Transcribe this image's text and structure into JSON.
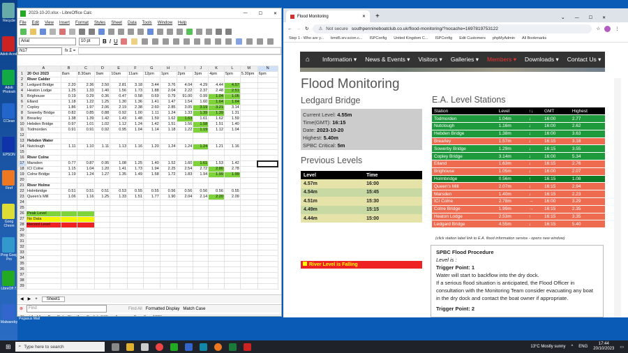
{
  "desktop": {
    "icons": [
      {
        "label": "Recycle",
        "color": "#6aa"
      },
      {
        "label": "Adob Acrob",
        "color": "#c22"
      },
      {
        "label": "Adob Photosh",
        "color": "#1a4"
      },
      {
        "label": "CClean",
        "color": "#26c"
      },
      {
        "label": "EPSON",
        "color": "#13a"
      },
      {
        "label": "Firef",
        "color": "#e72"
      },
      {
        "label": "Goog Chrom",
        "color": "#dd3"
      },
      {
        "label": "Prog Goog Pro",
        "color": "#39c"
      },
      {
        "label": "LibreOff 7.",
        "color": "#2a2"
      },
      {
        "label": "Malwareby",
        "color": "#36c"
      }
    ],
    "pegasus": "Pegasus Mail"
  },
  "calc": {
    "title": "2023-10-20.xlsx - LibreOffice Calc",
    "menu": [
      "File",
      "Edit",
      "View",
      "Insert",
      "Format",
      "Styles",
      "Sheet",
      "Data",
      "Tools",
      "Window",
      "Help"
    ],
    "font": "Arial",
    "size": "10 pt",
    "namebox": "N17",
    "formula_icons": "fx Σ =",
    "columns": [
      "",
      "A",
      "B",
      "C",
      "D",
      "E",
      "F",
      "G",
      "H",
      "I",
      "J",
      "K",
      "L",
      "M",
      "N"
    ],
    "rows": [
      [
        "1",
        "20 Oct 2023",
        "8am",
        "8.30am",
        "9am",
        "10am",
        "11am",
        "12pm",
        "1pm",
        "2pm",
        "3pm",
        "4pm",
        "5pm",
        "5.30pm",
        "6pm"
      ],
      [
        "2",
        "River Calder",
        "",
        "",
        "",
        "",
        "",
        "",
        "",
        "",
        "",
        "",
        "",
        "",
        ""
      ],
      [
        "3",
        "Ledgard Bridge",
        "2.20",
        "2.36",
        "2.50",
        "2.81",
        "3.18",
        "3.44",
        "3.76",
        "4.04",
        "4.29",
        "4.44",
        "4.57",
        "",
        ""
      ],
      [
        "4",
        "Heaton Lodge",
        "1.25",
        "1.33",
        "1.40",
        "1.56",
        "1.73",
        "1.88",
        "2.04",
        "2.22",
        "2.37",
        "2.48",
        "2.51",
        "",
        ""
      ],
      [
        "5",
        "Brighouse",
        "0.19",
        "0.29",
        "0.36",
        "0.47",
        "0.58",
        "0.69",
        "0.79",
        "91.00",
        "0.99",
        "1.04",
        "1.05",
        "",
        ""
      ],
      [
        "6",
        "Elland",
        "1.18",
        "1.22",
        "1.25",
        "1.30",
        "1.36",
        "1.41",
        "1.47",
        "1.54",
        "1.60",
        "1.64",
        "1.64",
        "",
        ""
      ],
      [
        "7",
        "Copley",
        "1.86",
        "1.97",
        "2.06",
        "2.19",
        "2.38",
        "2.60",
        "2.85",
        "3.05",
        "3.19",
        "3.21",
        "3.14",
        "",
        ""
      ],
      [
        "8",
        "Sowerby Bridge",
        "0.82",
        "0.85",
        "0.88",
        "0.92",
        "1.00",
        "1.11",
        "1.24",
        "1.33",
        "1.39",
        "1.39",
        "1.31",
        "",
        ""
      ],
      [
        "9",
        "Brearley",
        "1.38",
        "1.39",
        "1.42",
        "1.43",
        "1.48",
        "1.59",
        "1.62",
        "1.63",
        "1.61",
        "1.62",
        "1.59",
        "",
        ""
      ],
      [
        "10",
        "Hebden Bridge",
        "0.97",
        "1.01",
        "1.02",
        "1.12",
        "1.24",
        "1.42",
        "1.51",
        "1.56",
        "1.58",
        "1.51",
        "1.40",
        "",
        ""
      ],
      [
        "11",
        "Todmorden",
        "0.91",
        "0.91",
        "0.92",
        "0.95",
        "1.04",
        "1.14",
        "1.18",
        "1.22",
        "1.19",
        "1.12",
        "1.04",
        "",
        ""
      ],
      [
        "12",
        "",
        "",
        "",
        "",
        "",
        "",
        "",
        "",
        "",
        "",
        "",
        "",
        "",
        ""
      ],
      [
        "13",
        "Hebden Water",
        "",
        "",
        "",
        "",
        "",
        "",
        "",
        "",
        "",
        "",
        "",
        "",
        ""
      ],
      [
        "14",
        "Nutclough",
        "1.11",
        "1.10",
        "1.11",
        "1.13",
        "1.16",
        "1.20",
        "1.24",
        "1.24",
        "1.24",
        "1.21",
        "1.16",
        "",
        ""
      ],
      [
        "15",
        "",
        "",
        "",
        "",
        "",
        "",
        "",
        "",
        "",
        "",
        "",
        "",
        "",
        ""
      ],
      [
        "16",
        "River Colne",
        "",
        "",
        "",
        "",
        "",
        "",
        "",
        "",
        "",
        "",
        "",
        "",
        ""
      ],
      [
        "17",
        "Marsden",
        "0.77",
        "0.87",
        "0.95",
        "1.08",
        "1.25",
        "1.40",
        "1.52",
        "1.60",
        "1.61",
        "1.53",
        "1.42",
        "",
        ""
      ],
      [
        "18",
        "ICI Colne",
        "1.15",
        "1.04",
        "1.20",
        "1.41",
        "1.73",
        "1.94",
        "2.25",
        "2.54",
        "2.72",
        "2.80",
        "2.78",
        "",
        ""
      ],
      [
        "19",
        "Colne Bridge",
        "1.19",
        "1.24",
        "1.27",
        "1.35",
        "1.49",
        "1.58",
        "1.72",
        "1.83",
        "1.94",
        "1.99",
        "1.99",
        "",
        ""
      ],
      [
        "20",
        "",
        "",
        "",
        "",
        "",
        "",
        "",
        "",
        "",
        "",
        "",
        "",
        "",
        ""
      ],
      [
        "21",
        "River Holme",
        "",
        "",
        "",
        "",
        "",
        "",
        "",
        "",
        "",
        "",
        "",
        "",
        ""
      ],
      [
        "22",
        "Holmbridge",
        "0.51",
        "0.51",
        "0.51",
        "0.53",
        "0.55",
        "0.55",
        "0.56",
        "0.56",
        "0.56",
        "0.56",
        "0.55",
        "",
        ""
      ],
      [
        "23",
        "Queen's Mill",
        "1.06",
        "1.16",
        "1.25",
        "1.33",
        "1.51",
        "1.77",
        "1.90",
        "2.04",
        "2.14",
        "2.20",
        "2.09",
        "",
        ""
      ],
      [
        "24",
        "",
        "",
        "",
        "",
        "",
        "",
        "",
        "",
        "",
        "",
        "",
        "",
        "",
        ""
      ],
      [
        "25",
        "",
        "",
        "",
        "",
        "",
        "",
        "",
        "",
        "",
        "",
        "",
        "",
        "",
        ""
      ],
      [
        "26",
        "Peak Level",
        "",
        "",
        "",
        "",
        "",
        "",
        "",
        "",
        "",
        "",
        "",
        "",
        ""
      ],
      [
        "27",
        "No Data",
        "",
        "",
        "",
        "",
        "",
        "",
        "",
        "",
        "",
        "",
        "",
        "",
        ""
      ],
      [
        "28",
        "Record Level",
        "",
        "",
        "",
        "",
        "",
        "",
        "",
        "",
        "",
        "",
        "",
        "",
        ""
      ],
      [
        "29",
        "",
        "",
        "",
        "",
        "",
        "",
        "",
        "",
        "",
        "",
        "",
        "",
        "",
        ""
      ],
      [
        "30",
        "",
        "",
        "",
        "",
        "",
        "",
        "",
        "",
        "",
        "",
        "",
        "",
        "",
        ""
      ],
      [
        "31",
        "",
        "",
        "",
        "",
        "",
        "",
        "",
        "",
        "",
        "",
        "",
        "",
        "",
        ""
      ],
      [
        "32",
        "",
        "",
        "",
        "",
        "",
        "",
        "",
        "",
        "",
        "",
        "",
        "",
        "",
        ""
      ],
      [
        "33",
        "",
        "",
        "",
        "",
        "",
        "",
        "",
        "",
        "",
        "",
        "",
        "",
        "",
        ""
      ],
      [
        "34",
        "",
        "",
        "",
        "",
        "",
        "",
        "",
        "",
        "",
        "",
        "",
        "",
        "",
        ""
      ],
      [
        "35",
        "",
        "",
        "",
        "",
        "",
        "",
        "",
        "",
        "",
        "",
        "",
        "",
        "",
        ""
      ],
      [
        "36",
        "",
        "",
        "",
        "",
        "",
        "",
        "",
        "",
        "",
        "",
        "",
        "",
        "",
        ""
      ],
      [
        "37",
        "",
        "",
        "",
        "",
        "",
        "",
        "",
        "",
        "",
        "",
        "",
        "",
        "",
        ""
      ],
      [
        "38",
        "",
        "",
        "",
        "",
        "",
        "",
        "",
        "",
        "",
        "",
        "",
        "",
        "",
        ""
      ],
      [
        "39",
        "",
        "",
        "",
        "",
        "",
        "",
        "",
        "",
        "",
        "",
        "",
        "",
        "",
        ""
      ]
    ],
    "peak_color": "#7ed23a",
    "nodata_color": "#f5f500",
    "record_color": "#e22",
    "sheet_tab": "Sheet1",
    "find_placeholder": "Find",
    "find_all": "Find All",
    "formatted_display": "Formatted Display",
    "match_case": "Match Case",
    "status": [
      "Sheet 1 of 1",
      "PageStyle_Sheet1",
      "English (UK)",
      "Average: ; Sum: 0",
      "100%"
    ]
  },
  "chrome": {
    "tab_title": "Flood Monitoring",
    "not_secure": "Not secure",
    "url": "southpennineboatclub.co.uk/flood-monitoring/?nocache=1697819753122",
    "bookmarks": [
      "Step 1 - Who are y...",
      "bmd5.srv.scion.c...",
      "ISPConfig",
      "United Kingdom C...",
      "ISPConfig",
      "Edit Customers",
      "phpMyAdmin",
      "All Bookmarks"
    ],
    "nav": [
      "Information",
      "News & Events",
      "Visitors",
      "Galleries",
      "Members",
      "Downloads",
      "Contact Us"
    ],
    "heading": "Flood Monitoring",
    "station": "Ledgard Bridge",
    "current": {
      "label": "Current Level:",
      "value": "4.55m"
    },
    "time": {
      "label": "Time(GMT):",
      "value": "16:15"
    },
    "date": {
      "label": "Date:",
      "value": "2023-10-20"
    },
    "highest": {
      "label": "Highest:",
      "value": "5.40m"
    },
    "critical": {
      "label": "SPBC Critical:",
      "value": "5m"
    },
    "prev_title": "Previous Levels",
    "prev_headers": [
      "Level",
      "Time"
    ],
    "prev": [
      [
        "4.57m",
        "16:00"
      ],
      [
        "4.54m",
        "15:45"
      ],
      [
        "4.51m",
        "15:30"
      ],
      [
        "4.49m",
        "15:15"
      ],
      [
        "4.44m",
        "15:00"
      ]
    ],
    "falling": "River Level is Falling",
    "ea_title": "E.A. Level Stations",
    "ea_headers": [
      "Station",
      "Level",
      "↑↓",
      "GMT",
      "Highest"
    ],
    "ea": [
      [
        "Todmorden",
        "1.04m",
        "↓",
        "16:00",
        "2.77",
        "#1e9a3c"
      ],
      [
        "Nutclough",
        "1.16m",
        "↓",
        "16:00",
        "2.62",
        "#1e9a3c"
      ],
      [
        "Hebden Bridge",
        "1.38m",
        "↓",
        "16:00",
        "3.63",
        "#1e9a3c"
      ],
      [
        "Brearley",
        "1.57m",
        "↓",
        "16:15",
        "3.18",
        "#ef6b50"
      ],
      [
        "Sowerby Bridge",
        "1.29m",
        "↓",
        "16:15",
        "3.55",
        "#1e9a3c"
      ],
      [
        "Copley Bridge",
        "3.14m",
        "↓",
        "16:00",
        "5.34",
        "#1e9a3c"
      ],
      [
        "Elland",
        "1.63m",
        "↓",
        "16:15",
        "2.76",
        "#ef6b50"
      ],
      [
        "Brighouse",
        "1.05m",
        "↓",
        "16:00",
        "2.07",
        "#ef6b50"
      ],
      [
        "Holmbridge",
        "0.56m",
        "↑",
        "16:15",
        "1.08",
        "#0d7a26"
      ],
      [
        "Queen's Mill",
        "2.07m",
        "↓",
        "16:15",
        "2.94",
        "#ef6b50"
      ],
      [
        "Marsden",
        "1.40m",
        "↓",
        "16:15",
        "2.23",
        "#ef6b50"
      ],
      [
        "ICI Colne",
        "2.78m",
        "→",
        "16:00",
        "3.29",
        "#ef6b50"
      ],
      [
        "Colne Bridge",
        "1.99m",
        "→",
        "16:15",
        "2.35",
        "#ef6b50"
      ],
      [
        "Heaton Lodge",
        "2.53m",
        "↑",
        "16:15",
        "3.35",
        "#ef6b50"
      ],
      [
        "Ledgard Bridge",
        "4.55m",
        "↓",
        "16:15",
        "5.40",
        "#ef6b50"
      ]
    ],
    "ea_note": "(click station label link to E.A. flood information service - opens new window)",
    "proc_title": "SPBC Flood Procedure",
    "proc_is": "Level is :",
    "trig1": "Trigger Point: 1",
    "trig1_text1": "Water will start to backflow into the dry dock.",
    "trig1_text2": "If a serious flood situation is anticipated, the Flood Officer in consultation with the Monitoring Team consider evacuating any boat in the dry dock and contact the boat owner if appropriate.",
    "trig2": "Trigger Point: 2"
  },
  "taskbar": {
    "search": "Type here to search",
    "weather": "13°C  Mostly sunny",
    "lang": "ENG",
    "time": "17:44",
    "date": "20/10/2023"
  }
}
